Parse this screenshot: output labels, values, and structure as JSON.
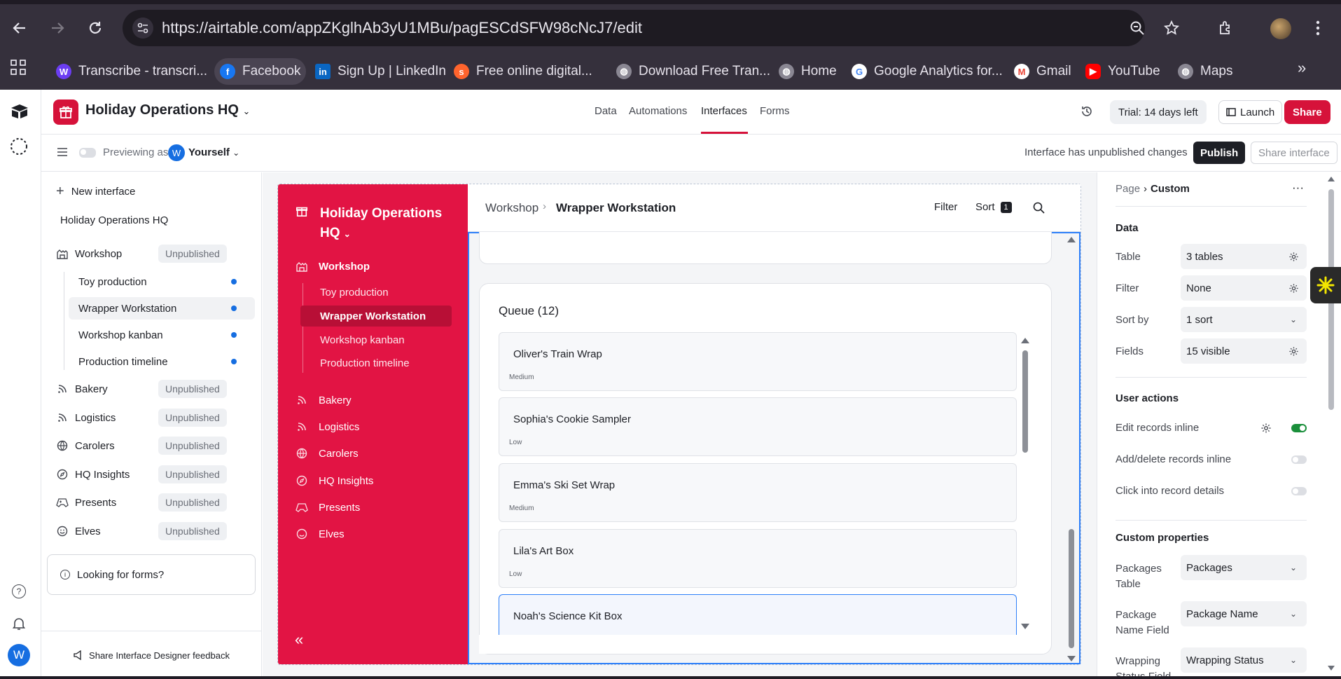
{
  "browser": {
    "url": "https://airtable.com/appZKglhAb3yU1MBu/pagESCdSFW98cNcJ7/edit",
    "bookmarks": [
      {
        "label": "Transcribe - transcri...",
        "icon": "transcribe-icon",
        "color": "#6b3df2"
      },
      {
        "label": "Facebook",
        "icon": "facebook-icon",
        "color": "#1877f2"
      },
      {
        "label": "Sign Up | LinkedIn",
        "icon": "linkedin-icon",
        "color": "#0a66c2"
      },
      {
        "label": "Free online digital...",
        "icon": "semrush-icon",
        "color": "#ff642d"
      },
      {
        "label": "Download Free Tran...",
        "icon": "globe-icon",
        "color": "#8a8793"
      },
      {
        "label": "Home",
        "icon": "globe-icon",
        "color": "#8a8793"
      },
      {
        "label": "Google Analytics for...",
        "icon": "google-icon",
        "color": "#4285f4"
      },
      {
        "label": "Gmail",
        "icon": "gmail-icon",
        "color": "#ea4335"
      },
      {
        "label": "YouTube",
        "icon": "youtube-icon",
        "color": "#ff0000"
      },
      {
        "label": "Maps",
        "icon": "globe-icon",
        "color": "#8a8793"
      }
    ]
  },
  "app": {
    "base_name": "Holiday Operations HQ",
    "nav": [
      "Data",
      "Automations",
      "Interfaces",
      "Forms"
    ],
    "active_nav": "Interfaces",
    "trial": "Trial: 14 days left",
    "launch": "Launch",
    "share": "Share",
    "accent": "#d6123a",
    "avatar_letter": "W"
  },
  "subheader": {
    "previewing_as": "Previewing as",
    "user": "Yourself",
    "user_initial": "W",
    "unpublished_msg": "Interface has unpublished changes",
    "publish": "Publish",
    "share_interface": "Share interface"
  },
  "sidebar": {
    "new_interface": "New interface",
    "title": "Holiday Operations HQ",
    "groups": [
      {
        "label": "Workshop",
        "badge": "Unpublished",
        "icon": "workshop-icon"
      },
      {
        "label": "Bakery",
        "badge": "Unpublished",
        "icon": "rss-icon"
      },
      {
        "label": "Logistics",
        "badge": "Unpublished",
        "icon": "rss-icon"
      },
      {
        "label": "Carolers",
        "badge": "Unpublished",
        "icon": "globe-icon"
      },
      {
        "label": "HQ Insights",
        "badge": "Unpublished",
        "icon": "compass-icon"
      },
      {
        "label": "Presents",
        "badge": "Unpublished",
        "icon": "gamepad-icon"
      },
      {
        "label": "Elves",
        "badge": "Unpublished",
        "icon": "smile-icon"
      }
    ],
    "pages": [
      "Toy production",
      "Wrapper Workstation",
      "Workshop kanban",
      "Production timeline"
    ],
    "forms_prompt": "Looking for forms?",
    "feedback": "Share Interface Designer feedback"
  },
  "interface": {
    "title_line1": "Holiday Operations",
    "title_line2": "HQ",
    "breadcrumb_parent": "Workshop",
    "breadcrumb_current": "Wrapper Workstation",
    "filter": "Filter",
    "sort": "Sort",
    "sort_count": "1",
    "nav_groups": [
      "Workshop",
      "Bakery",
      "Logistics",
      "Carolers",
      "HQ Insights",
      "Presents",
      "Elves"
    ],
    "nav_pages": [
      "Toy production",
      "Wrapper Workstation",
      "Workshop kanban",
      "Production timeline"
    ],
    "queue_title": "Queue (12)",
    "records": [
      {
        "name": "Oliver's Train Wrap",
        "priority": "Medium"
      },
      {
        "name": "Sophia's Cookie Sampler",
        "priority": "Low"
      },
      {
        "name": "Emma's Ski Set Wrap",
        "priority": "Medium"
      },
      {
        "name": "Lila's Art Box",
        "priority": "Low"
      },
      {
        "name": "Noah's Science Kit Box",
        "priority": ""
      }
    ]
  },
  "panel": {
    "crumb_root": "Page",
    "crumb_current": "Custom",
    "data_heading": "Data",
    "fields": [
      {
        "label": "Table",
        "value": "3 tables"
      },
      {
        "label": "Filter",
        "value": "None"
      },
      {
        "label": "Sort by",
        "value": "1 sort"
      },
      {
        "label": "Fields",
        "value": "15 visible"
      }
    ],
    "user_actions_heading": "User actions",
    "actions": [
      {
        "label": "Edit records inline",
        "on": true
      },
      {
        "label": "Add/delete records inline",
        "on": false
      },
      {
        "label": "Click into record details",
        "on": false
      }
    ],
    "custom_heading": "Custom properties",
    "custom": [
      {
        "label1": "Packages",
        "label2": "Table",
        "value": "Packages"
      },
      {
        "label1": "Package",
        "label2": "Name Field",
        "value": "Package Name"
      },
      {
        "label1": "Wrapping",
        "label2": "Status Field",
        "value": "Wrapping Status"
      }
    ]
  }
}
